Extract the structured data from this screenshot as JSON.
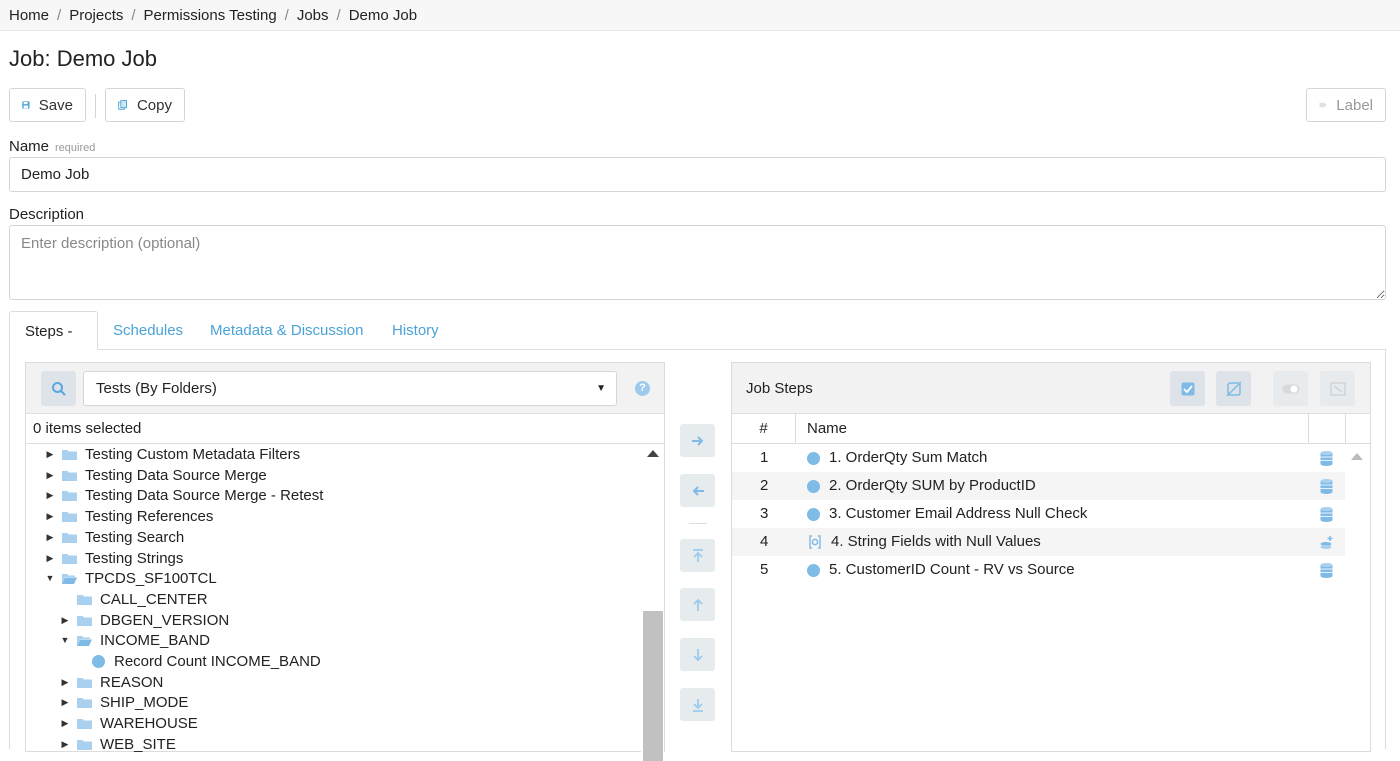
{
  "breadcrumb": [
    "Home",
    "Projects",
    "Permissions Testing",
    "Jobs",
    "Demo Job"
  ],
  "page_title": "Job: Demo Job",
  "toolbar": {
    "save_label": "Save",
    "copy_label": "Copy",
    "label_label": "Label"
  },
  "form": {
    "name_label": "Name",
    "name_required": "required",
    "name_value": "Demo Job",
    "description_label": "Description",
    "description_placeholder": "Enter description (optional)"
  },
  "tabs": [
    {
      "label": "Steps - 5",
      "active": true
    },
    {
      "label": "Schedules",
      "active": false
    },
    {
      "label": "Metadata & Discussion",
      "active": false
    },
    {
      "label": "History",
      "active": false
    }
  ],
  "left_panel": {
    "select_value": "Tests (By Folders)",
    "selected_count": "0 items selected",
    "tree": [
      {
        "label": "Testing Custom Metadata Filters",
        "level": 0,
        "type": "folder",
        "expanded": false
      },
      {
        "label": "Testing Data Source Merge",
        "level": 0,
        "type": "folder",
        "expanded": false
      },
      {
        "label": "Testing Data Source Merge - Retest",
        "level": 0,
        "type": "folder",
        "expanded": false
      },
      {
        "label": "Testing References",
        "level": 0,
        "type": "folder",
        "expanded": false
      },
      {
        "label": "Testing Search",
        "level": 0,
        "type": "folder",
        "expanded": false
      },
      {
        "label": "Testing Strings",
        "level": 0,
        "type": "folder",
        "expanded": false
      },
      {
        "label": "TPCDS_SF100TCL",
        "level": 0,
        "type": "folder",
        "expanded": true
      },
      {
        "label": "CALL_CENTER",
        "level": 1,
        "type": "folder-leaf",
        "expanded": false
      },
      {
        "label": "DBGEN_VERSION",
        "level": 1,
        "type": "folder",
        "expanded": false
      },
      {
        "label": "INCOME_BAND",
        "level": 1,
        "type": "folder",
        "expanded": true
      },
      {
        "label": "Record Count INCOME_BAND",
        "level": 2,
        "type": "test",
        "expanded": false
      },
      {
        "label": "REASON",
        "level": 1,
        "type": "folder",
        "expanded": false
      },
      {
        "label": "SHIP_MODE",
        "level": 1,
        "type": "folder",
        "expanded": false
      },
      {
        "label": "WAREHOUSE",
        "level": 1,
        "type": "folder",
        "expanded": false
      },
      {
        "label": "WEB_SITE",
        "level": 1,
        "type": "folder",
        "expanded": false
      }
    ]
  },
  "right_panel": {
    "title": "Job Steps",
    "columns": {
      "num": "#",
      "name": "Name"
    },
    "rows": [
      {
        "num": "1",
        "name": "1. OrderQty Sum Match",
        "icon": "check-circle-icon"
      },
      {
        "num": "2",
        "name": "2. OrderQty SUM by ProductID",
        "icon": "check-circle-icon"
      },
      {
        "num": "3",
        "name": "3. Customer Email Address Null Check",
        "icon": "check-circle-icon"
      },
      {
        "num": "4",
        "name": "4. String Fields with Null Values",
        "icon": "gear-cog-icon"
      },
      {
        "num": "5",
        "name": "5. CustomerID Count - RV vs Source",
        "icon": "check-circle-icon"
      }
    ]
  },
  "colors": {
    "accent": "#4aa3d6",
    "icon_blue": "#7fbbe6",
    "border": "#dcdcdc"
  }
}
